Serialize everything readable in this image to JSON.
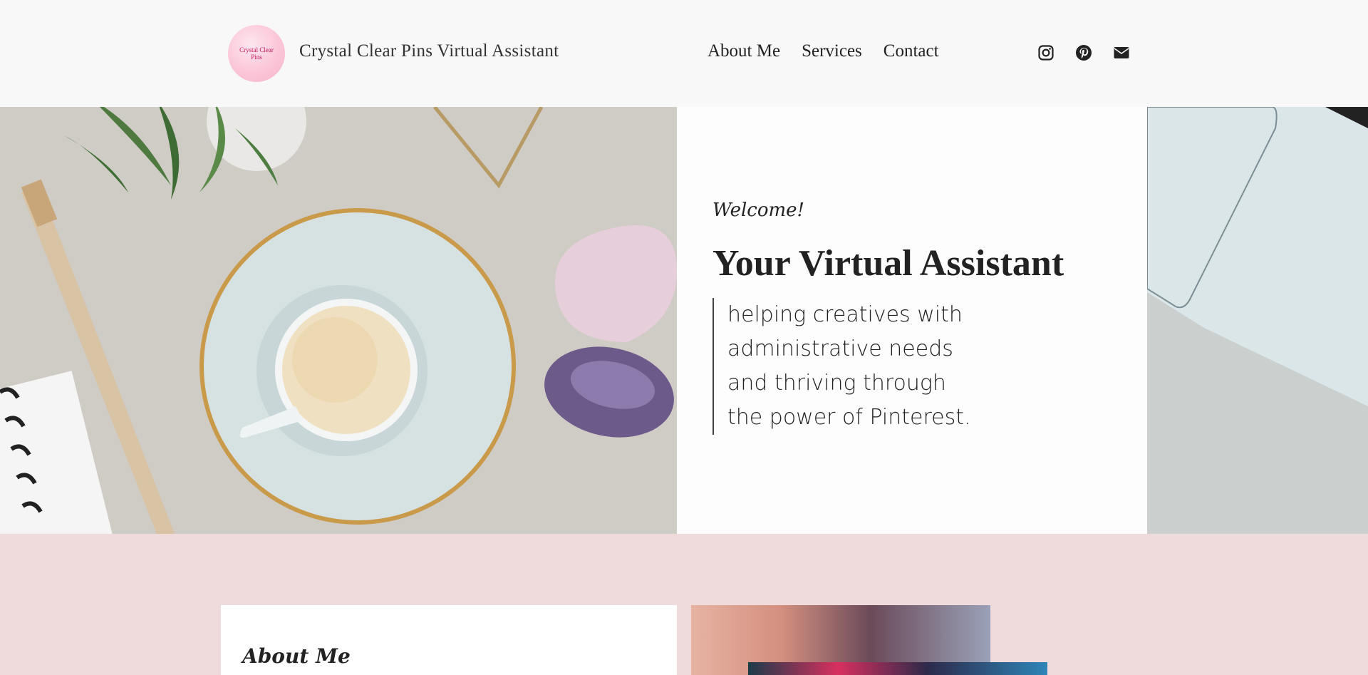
{
  "header": {
    "logo_text": "Crystal Clear Pins",
    "site_title": "Crystal Clear Pins Virtual Assistant",
    "nav": [
      {
        "label": "About Me"
      },
      {
        "label": "Services"
      },
      {
        "label": "Contact"
      }
    ],
    "social": [
      "instagram-icon",
      "pinterest-icon",
      "envelope-icon"
    ]
  },
  "hero": {
    "welcome": "Welcome!",
    "heading": "Your Virtual Assistant",
    "quote_lines": [
      "helping creatives with",
      "administrative needs",
      "and thriving through",
      "the power of Pinterest."
    ]
  },
  "about": {
    "title": "About Me"
  },
  "colors": {
    "header_bg": "#f8f8f8",
    "about_bg": "#efdbdc",
    "text": "#222222"
  }
}
